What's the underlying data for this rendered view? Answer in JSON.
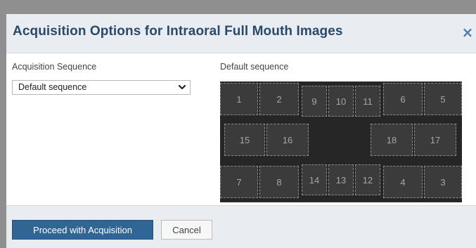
{
  "dialog": {
    "title": "Acquisition Options for Intraoral Full Mouth Images",
    "close_icon": "close-icon",
    "close_glyph": "×"
  },
  "acquisition_sequence": {
    "label": "Acquisition Sequence",
    "selected": "Default sequence"
  },
  "preview": {
    "label": "Default sequence",
    "rows": [
      [
        "1",
        "2",
        "9",
        "10",
        "11",
        "6",
        "5"
      ],
      [
        "15",
        "16",
        "18",
        "17"
      ],
      [
        "7",
        "8",
        "14",
        "13",
        "12",
        "4",
        "3"
      ]
    ]
  },
  "footer": {
    "proceed_label": "Proceed with Acquisition",
    "cancel_label": "Cancel"
  },
  "colors": {
    "title": "#2a4a69",
    "accent": "#2f6695",
    "header_bg": "#e9edf1",
    "grid_bg": "#262626",
    "tile_bg": "#3b3b3b"
  }
}
